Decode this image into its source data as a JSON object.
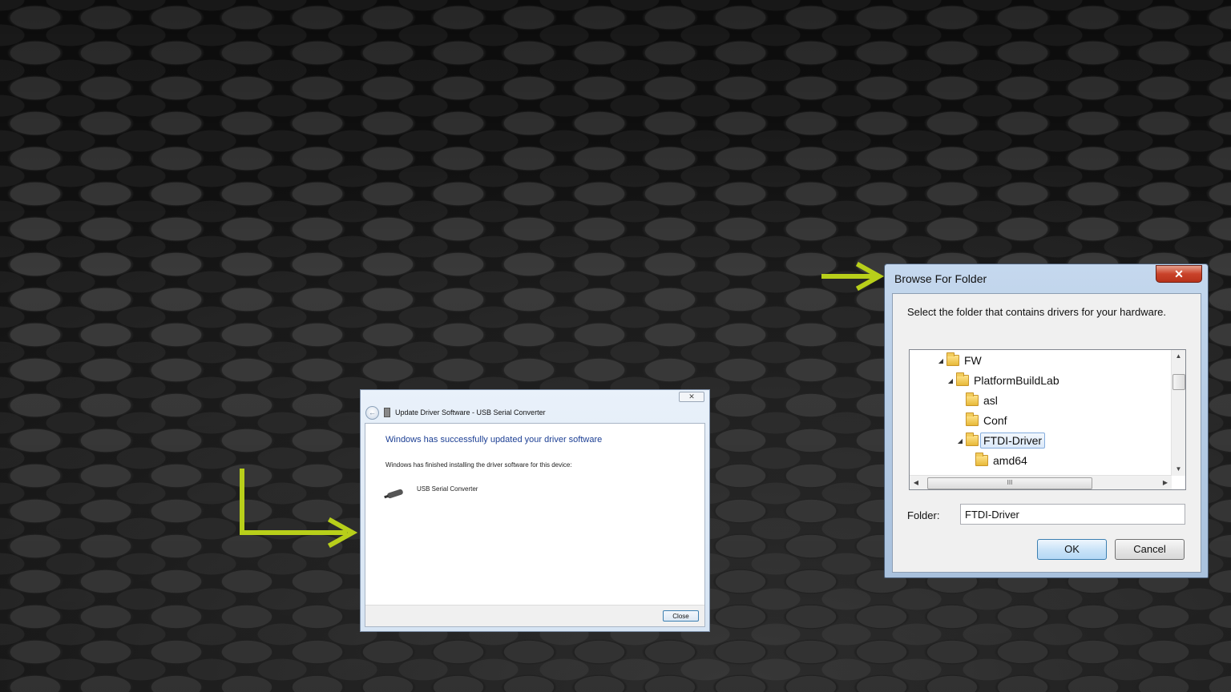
{
  "colors": {
    "arrow": "#b8cf1a",
    "heading_blue": "#1c3f94",
    "close_red": "#c9432a"
  },
  "update_driver": {
    "title": "Update Driver Software - USB Serial Converter",
    "close_glyph": "✕",
    "back_glyph": "←",
    "heading": "Windows has successfully updated your driver software",
    "description": "Windows has finished installing the driver software for this device:",
    "device_name": "USB Serial Converter",
    "close_button": "Close"
  },
  "browse_folder": {
    "title": "Browse For Folder",
    "close_glyph": "✕",
    "prompt": "Select the folder that contains drivers for your hardware.",
    "tree": [
      {
        "label": "FW",
        "expanded": true
      },
      {
        "label": "PlatformBuildLab",
        "expanded": true
      },
      {
        "label": "asl"
      },
      {
        "label": "Conf"
      },
      {
        "label": "FTDI-Driver",
        "expanded": true,
        "selected": true
      },
      {
        "label": "amd64"
      }
    ],
    "expander_glyph": "◢",
    "hscroll_grip": "III",
    "folder_label": "Folder:",
    "folder_value": "FTDI-Driver",
    "ok_button": "OK",
    "cancel_button": "Cancel"
  }
}
